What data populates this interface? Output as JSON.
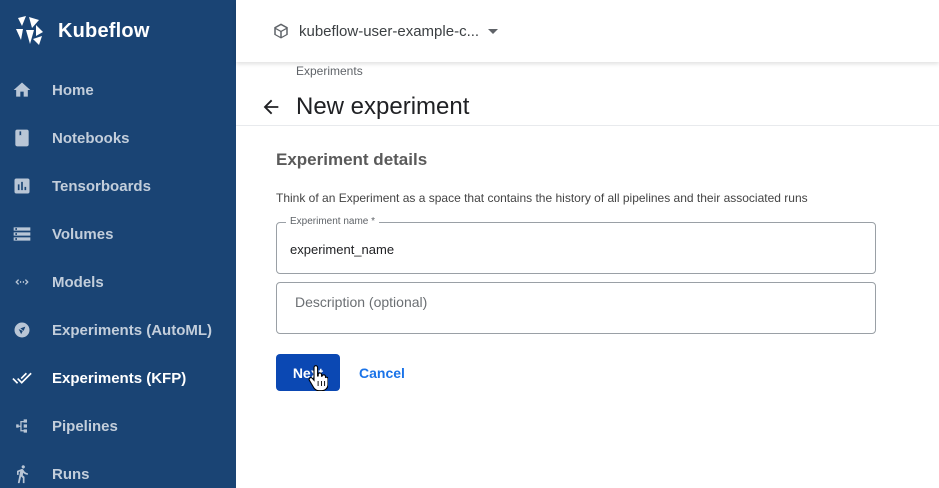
{
  "app": {
    "brand": "Kubeflow",
    "colors": {
      "sidebar_bg": "#1a4474",
      "primary_button": "#0b48b3",
      "link": "#1a73e8"
    }
  },
  "sidebar": {
    "items": [
      {
        "label": "Home",
        "icon": "home-icon",
        "active": false
      },
      {
        "label": "Notebooks",
        "icon": "notebook-icon",
        "active": false
      },
      {
        "label": "Tensorboards",
        "icon": "chart-icon",
        "active": false
      },
      {
        "label": "Volumes",
        "icon": "storage-icon",
        "active": false
      },
      {
        "label": "Models",
        "icon": "code-arrows-icon",
        "active": false
      },
      {
        "label": "Experiments (AutoML)",
        "icon": "katib-icon",
        "active": false
      },
      {
        "label": "Experiments (KFP)",
        "icon": "done-all-icon",
        "active": true
      },
      {
        "label": "Pipelines",
        "icon": "pipeline-icon",
        "active": false
      },
      {
        "label": "Runs",
        "icon": "running-icon",
        "active": false
      }
    ]
  },
  "topbar": {
    "namespace": "kubeflow-user-example-c...",
    "namespace_icon": "cube-icon"
  },
  "main": {
    "breadcrumb": "Experiments",
    "title": "New experiment",
    "section_title": "Experiment details",
    "section_description": "Think of an Experiment as a space that contains the history of all pipelines and their associated runs",
    "form": {
      "name_label": "Experiment name *",
      "name_value": "experiment_name",
      "description_placeholder": "Description (optional)",
      "description_value": ""
    },
    "buttons": {
      "next": "Next",
      "cancel": "Cancel"
    }
  }
}
